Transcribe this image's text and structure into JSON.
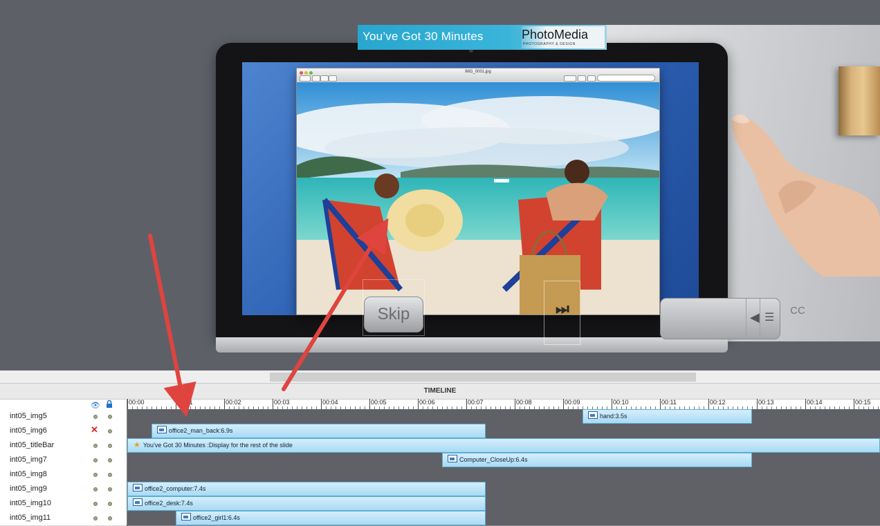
{
  "slide": {
    "title_banner": "You’ve Got 30 Minutes",
    "logo_text": "PhotoMedia",
    "logo_sub": "PHOTOGRAPHY & DESIGN",
    "viewer_title": "IMG_0001.jpg",
    "skip_label": "Skip",
    "cc_label": "CC",
    "next_icon": "next-icon",
    "volume_icon": "speaker-icon",
    "menu_icon": "menu-lines-icon"
  },
  "timeline": {
    "title": "TIMELINE",
    "header_icons": [
      "eye-icon",
      "lock-icon"
    ],
    "ruler": [
      "00:00",
      "00:01",
      "00:02",
      "00:03",
      "00:04",
      "00:05",
      "00:06",
      "00:07",
      "00:08",
      "00:09",
      "00:10",
      "00:11",
      "00:12",
      "00:13",
      "00:14",
      "00:15"
    ],
    "rows": [
      {
        "name": "int05_img5",
        "hidden": false,
        "bar": {
          "label": "hand:3.5s",
          "start_s": 9.4,
          "duration_s": 3.5,
          "icon": "image-icon"
        }
      },
      {
        "name": "int05_img6",
        "hidden": true,
        "bar": {
          "label": "office2_man_back:6.9s",
          "start_s": 0.5,
          "duration_s": 6.9,
          "icon": "image-icon"
        }
      },
      {
        "name": "int05_titleBar",
        "hidden": false,
        "bar": {
          "label": "You've Got 30 Minutes :Display for the rest of the slide",
          "start_s": 0.0,
          "duration_s": 15.6,
          "icon": "star-icon"
        }
      },
      {
        "name": "int05_img7",
        "hidden": false,
        "bar": {
          "label": "Computer_CloseUp:6.4s",
          "start_s": 6.5,
          "duration_s": 6.4,
          "icon": "image-icon"
        }
      },
      {
        "name": "int05_img8",
        "hidden": false,
        "bar": null
      },
      {
        "name": "int05_img9",
        "hidden": false,
        "bar": {
          "label": "office2_computer:7.4s",
          "start_s": 0.0,
          "duration_s": 7.4,
          "icon": "image-icon"
        }
      },
      {
        "name": "int05_img10",
        "hidden": false,
        "bar": {
          "label": "office2_desk:7.4s",
          "start_s": 0.0,
          "duration_s": 7.4,
          "icon": "image-icon"
        }
      },
      {
        "name": "int05_img11",
        "hidden": false,
        "bar": {
          "label": "office2_girl1:6.4s",
          "start_s": 1.0,
          "duration_s": 6.4,
          "icon": "image-icon"
        }
      }
    ]
  },
  "colors": {
    "track_bg": "#5f6167",
    "bar_fill": "#b8e2f7",
    "bar_border": "#5aaed6",
    "annotation_arrow": "#e0443e",
    "banner": "#30acd4"
  }
}
